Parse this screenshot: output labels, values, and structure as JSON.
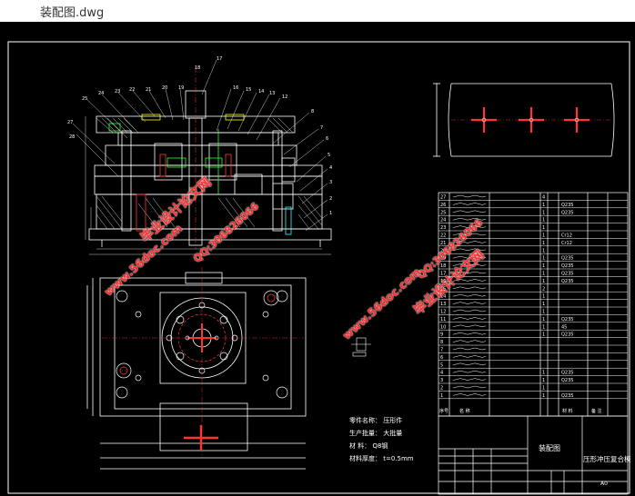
{
  "window": {
    "title": "装配图.dwg"
  },
  "notes": {
    "name": "零件名称：  压形件",
    "production": "生产批量：  大批量",
    "material": "材    料：  Q8钢",
    "thickness": "材料厚度： t=0.5mm"
  },
  "watermarks": [
    {
      "text": "毕业设计论文网"
    },
    {
      "text": "www.56doc.com"
    },
    {
      "text": "QQ:306826066"
    },
    {
      "text": "QQ:306826066"
    },
    {
      "text": "www.56doc.com"
    },
    {
      "text": "毕业设计论文网"
    }
  ],
  "bom": {
    "rows": [
      {
        "no": "27",
        "qty": "4",
        "material": ""
      },
      {
        "no": "26",
        "qty": "1",
        "material": "Q235"
      },
      {
        "no": "25",
        "qty": "1",
        "material": "Q235"
      },
      {
        "no": "24",
        "qty": "1",
        "material": ""
      },
      {
        "no": "23",
        "qty": "1",
        "material": ""
      },
      {
        "no": "22",
        "qty": "1",
        "material": "Cr12"
      },
      {
        "no": "21",
        "qty": "1",
        "material": "Cr12"
      },
      {
        "no": "20",
        "qty": "1",
        "material": ""
      },
      {
        "no": "19",
        "qty": "1",
        "material": "Q235"
      },
      {
        "no": "18",
        "qty": "1",
        "material": "Q235"
      },
      {
        "no": "17",
        "qty": "1",
        "material": "Q235"
      },
      {
        "no": "16",
        "qty": "1",
        "material": "Q235"
      },
      {
        "no": "15",
        "qty": "2",
        "material": ""
      },
      {
        "no": "14",
        "qty": "1",
        "material": ""
      },
      {
        "no": "13",
        "qty": "1",
        "material": ""
      },
      {
        "no": "12",
        "qty": "1",
        "material": ""
      },
      {
        "no": "11",
        "qty": "1",
        "material": "Q235"
      },
      {
        "no": "10",
        "qty": "1",
        "material": "45"
      },
      {
        "no": "9",
        "qty": "1",
        "material": "Q235"
      },
      {
        "no": "8",
        "qty": "",
        "material": ""
      },
      {
        "no": "7",
        "qty": "",
        "material": ""
      },
      {
        "no": "6",
        "qty": "",
        "material": ""
      },
      {
        "no": "5",
        "qty": "",
        "material": ""
      },
      {
        "no": "4",
        "qty": "1",
        "material": "Q235"
      },
      {
        "no": "3",
        "qty": "1",
        "material": "Q235"
      },
      {
        "no": "2",
        "qty": "1",
        "material": ""
      },
      {
        "no": "1",
        "qty": "1",
        "material": "Q235"
      }
    ],
    "header": {
      "no": "序号",
      "name": "名 称",
      "material": "材 料",
      "remark": "备 注"
    }
  },
  "titleblock": {
    "drawing": "装配图",
    "part": "压形冲压复合模",
    "sheet": "A0"
  },
  "colors": {
    "background": "#000000",
    "lines": "#ffffff",
    "accent_red": "#ff3333",
    "green": "#33ff33",
    "yellow": "#ffff00",
    "cyan": "#33ffff"
  }
}
